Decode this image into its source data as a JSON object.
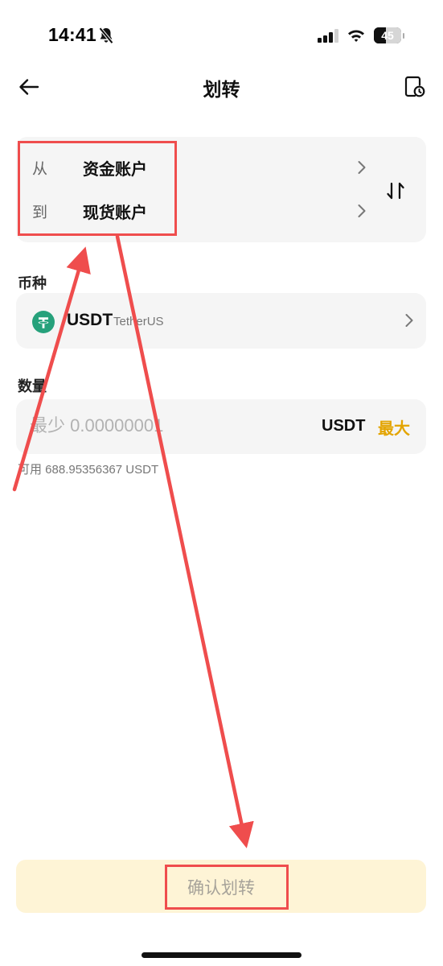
{
  "status_bar": {
    "time": "14:41",
    "battery": "45",
    "battery_level": 0.45,
    "icons": [
      "bell-off-icon",
      "signal-icon",
      "wifi-icon",
      "battery-icon"
    ]
  },
  "header": {
    "title": "划转",
    "back_icon": "arrow-left-icon",
    "history_icon": "transfer-history-icon"
  },
  "transfer": {
    "from_label": "从",
    "from_account": "资金账户",
    "to_label": "到",
    "to_account": "现货账户",
    "swap_icon": "swap-vertical-icon"
  },
  "coin": {
    "section_label": "币种",
    "symbol": "USDT",
    "name": "TetherUS",
    "logo": "tether-logo-icon",
    "logo_color": "#26a17b"
  },
  "amount": {
    "section_label": "数量",
    "placeholder": "最少 0.00000001",
    "value": "",
    "unit": "USDT",
    "max_label": "最大",
    "available": "可用 688.95356367 USDT"
  },
  "confirm": {
    "label": "确认划转"
  },
  "colors": {
    "accent": "#e3a400",
    "confirm_bg": "#fef4d6",
    "card_bg": "#f5f5f5",
    "annotation": "#ef4d4d"
  },
  "annotations": {
    "type": "red boxes and arrows",
    "targets": [
      "transfer-account-selector",
      "confirm-transfer-button"
    ]
  }
}
